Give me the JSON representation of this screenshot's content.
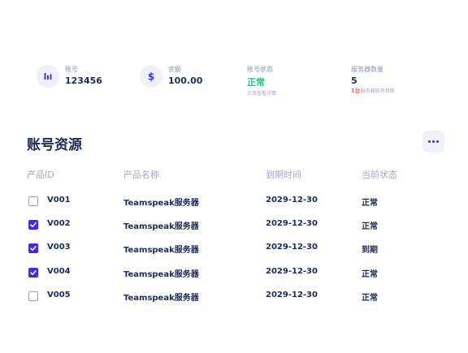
{
  "stats": [
    {
      "icon": "bar-chart-icon",
      "label": "账号",
      "value": "123456"
    },
    {
      "icon": "dollar-icon",
      "label": "余额",
      "value": "100.00"
    },
    {
      "label": "账号状态",
      "value": "正常",
      "value_color": "#17c48f",
      "note": "点我查看详情"
    },
    {
      "label": "服务器数量",
      "value": "5",
      "note_red": "1台",
      "note": "服务器即将到期"
    }
  ],
  "section": {
    "title": "账号资源"
  },
  "table": {
    "headers": [
      "产品ID",
      "产品名称",
      "到期时间",
      "当前状态"
    ],
    "rows": [
      {
        "checked": false,
        "id": "V001",
        "name": "Teamspeak服务器",
        "expires": "2029-12-30",
        "status": "正常"
      },
      {
        "checked": true,
        "id": "V002",
        "name": "Teamspeak服务器",
        "expires": "2029-12-30",
        "status": "正常"
      },
      {
        "checked": true,
        "id": "V003",
        "name": "Teamspeak服务器",
        "expires": "2029-12-30",
        "status": "到期"
      },
      {
        "checked": true,
        "id": "V004",
        "name": "Teamspeak服务器",
        "expires": "2029-12-30",
        "status": "正常"
      },
      {
        "checked": false,
        "id": "V005",
        "name": "Teamspeak服务器",
        "expires": "2029-12-30",
        "status": "正常"
      }
    ]
  },
  "colors": {
    "accent": "#4a26e6",
    "text": "#1f2a55",
    "muted": "#a2a8c4",
    "green": "#17c48f",
    "red": "#e02424"
  }
}
